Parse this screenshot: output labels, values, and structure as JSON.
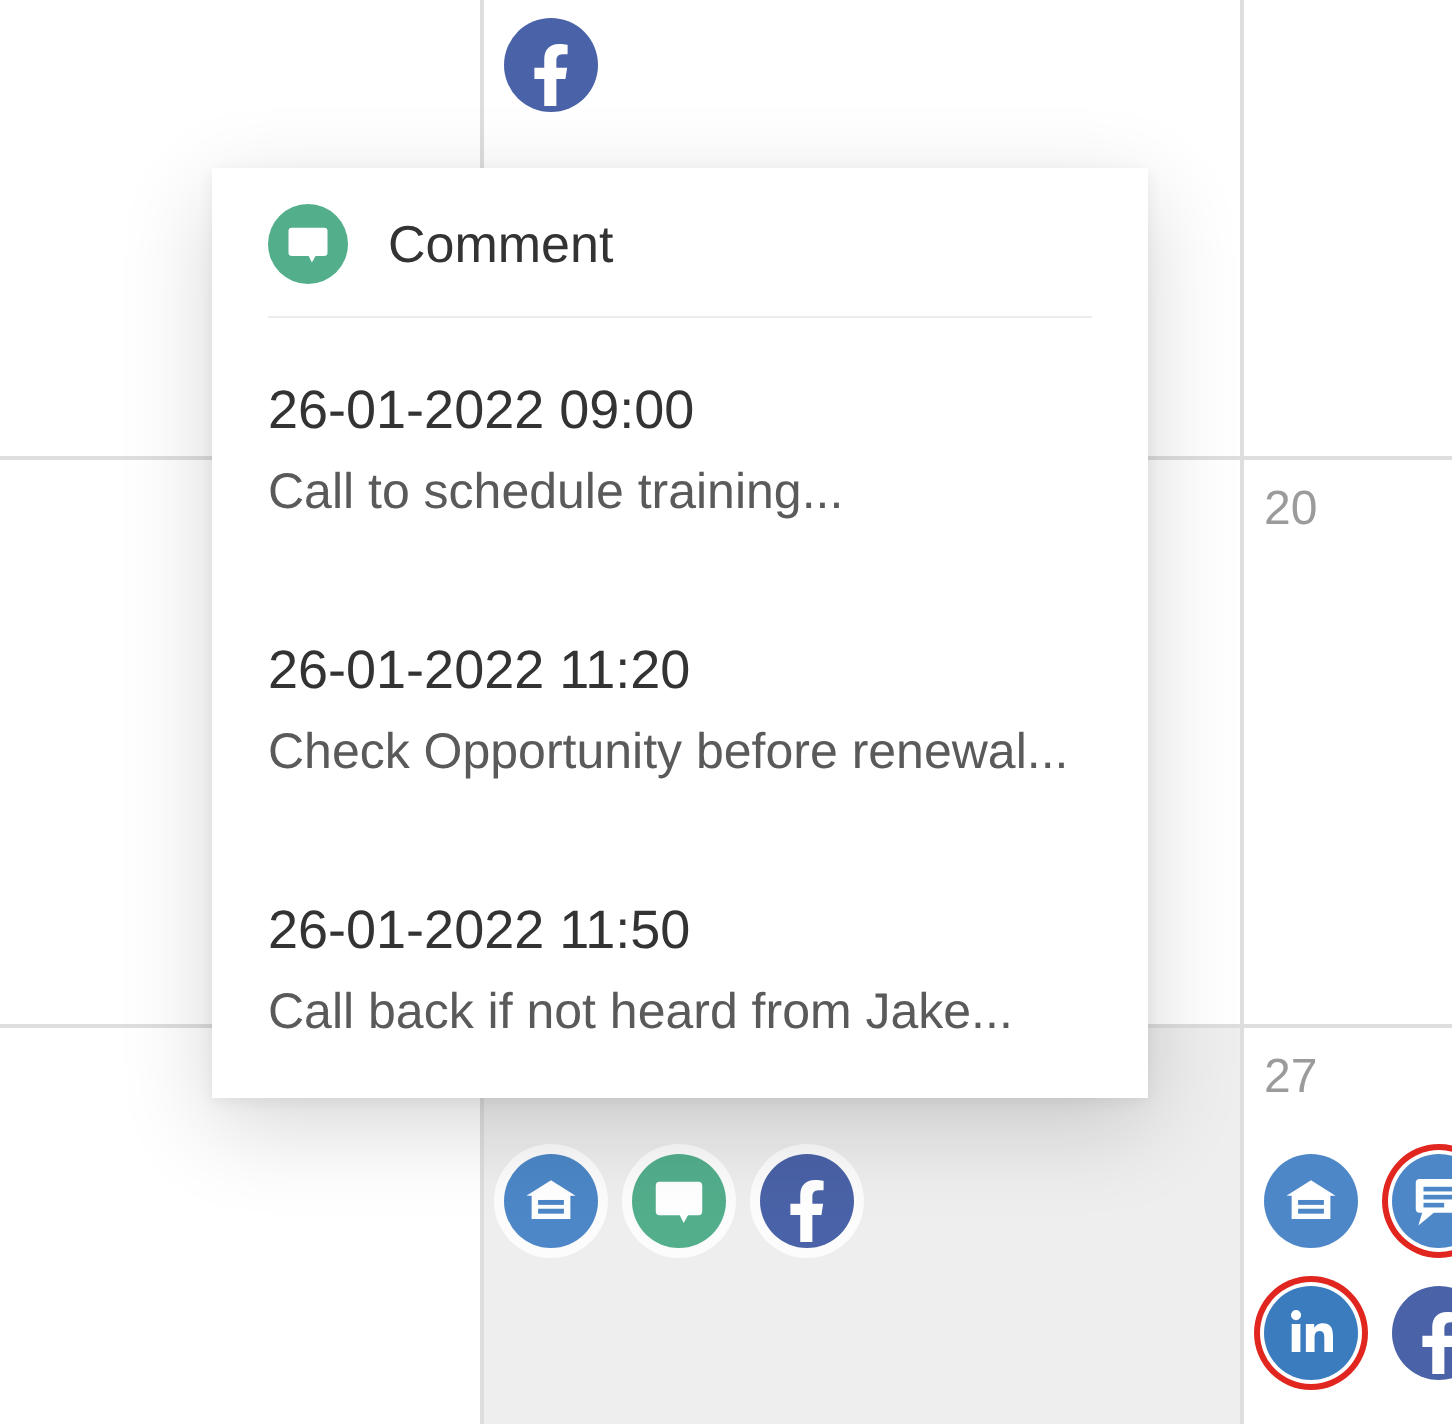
{
  "calendar": {
    "weeks": [
      {
        "days": [
          {
            "selected": false
          },
          {
            "selected": false,
            "activities": [
              {
                "kind": "facebook",
                "flagged": false
              }
            ]
          },
          {
            "selected": false
          }
        ]
      },
      {
        "days": [
          {
            "selected": false
          },
          {
            "selected": false
          },
          {
            "selected": false,
            "day": "20"
          }
        ]
      },
      {
        "days": [
          {
            "selected": false
          },
          {
            "selected": true,
            "activities": [
              {
                "kind": "building",
                "flagged": false
              },
              {
                "kind": "comment",
                "flagged": false
              },
              {
                "kind": "facebook",
                "flagged": false
              }
            ]
          },
          {
            "selected": false,
            "day": "27",
            "activities": [
              {
                "kind": "building",
                "flagged": false
              },
              {
                "kind": "message",
                "flagged": true
              },
              {
                "kind": "linkedin",
                "flagged": true
              },
              {
                "kind": "facebook",
                "flagged": false
              }
            ]
          }
        ]
      }
    ]
  },
  "popup": {
    "kind": "comment",
    "title": "Comment",
    "entries": [
      {
        "datetime": "26-01-2022 09:00",
        "text": "Call to schedule training..."
      },
      {
        "datetime": "26-01-2022 11:20",
        "text": "Check Opportunity before renewal..."
      },
      {
        "datetime": "26-01-2022 11:50",
        "text": "Call back if not heard from Jake..."
      }
    ]
  }
}
